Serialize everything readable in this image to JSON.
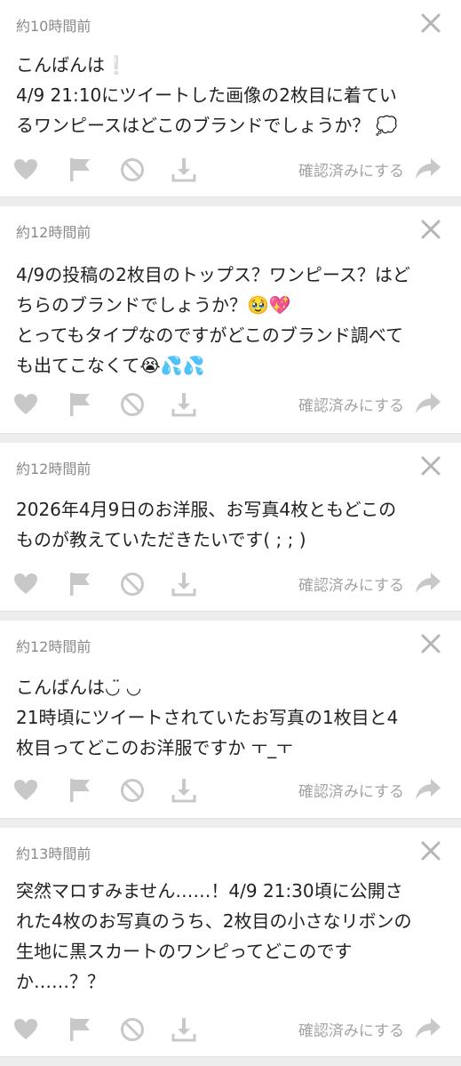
{
  "labels": {
    "confirm": "確認済みにする"
  },
  "colors": {
    "icon": "#c8c8c8",
    "text": "#222222",
    "meta": "#8a8a8a"
  },
  "messages": [
    {
      "time": "約10時間前",
      "lines": [
        "こんばんは❕",
        "4/9 21:10にツイートした画像の2枚目に着てい",
        "るワンピースはどこのブランドでしょうか？ 💭"
      ]
    },
    {
      "time": "約12時間前",
      "lines": [
        "4/9の投稿の2枚目のトップス？ワンピース？はど",
        "ちらのブランドでしょうか？🥹💖",
        "とってもタイプなのですがどこのブランド調べて",
        "も出てこなくて😭💦💦"
      ]
    },
    {
      "time": "約12時間前",
      "lines": [
        "2026年4月9日のお洋服、お写真4枚ともどこの",
        "ものが教えていただきたいです( ; ; )"
      ]
    },
    {
      "time": "約12時間前",
      "lines": [
        "こんばんは◡̈ ◡",
        "21時頃にツイートされていたお写真の1枚目と4",
        "枚目ってどこのお洋服ですか ㅜ_ㅜ"
      ]
    },
    {
      "time": "約13時間前",
      "lines": [
        "突然マロすみません……！4/9 21:30頃に公開さ",
        "れた4枚のお写真のうち、2枚目の小さなリボンの",
        "生地に黒スカートのワンピってどこのです",
        "か……？？"
      ]
    }
  ]
}
